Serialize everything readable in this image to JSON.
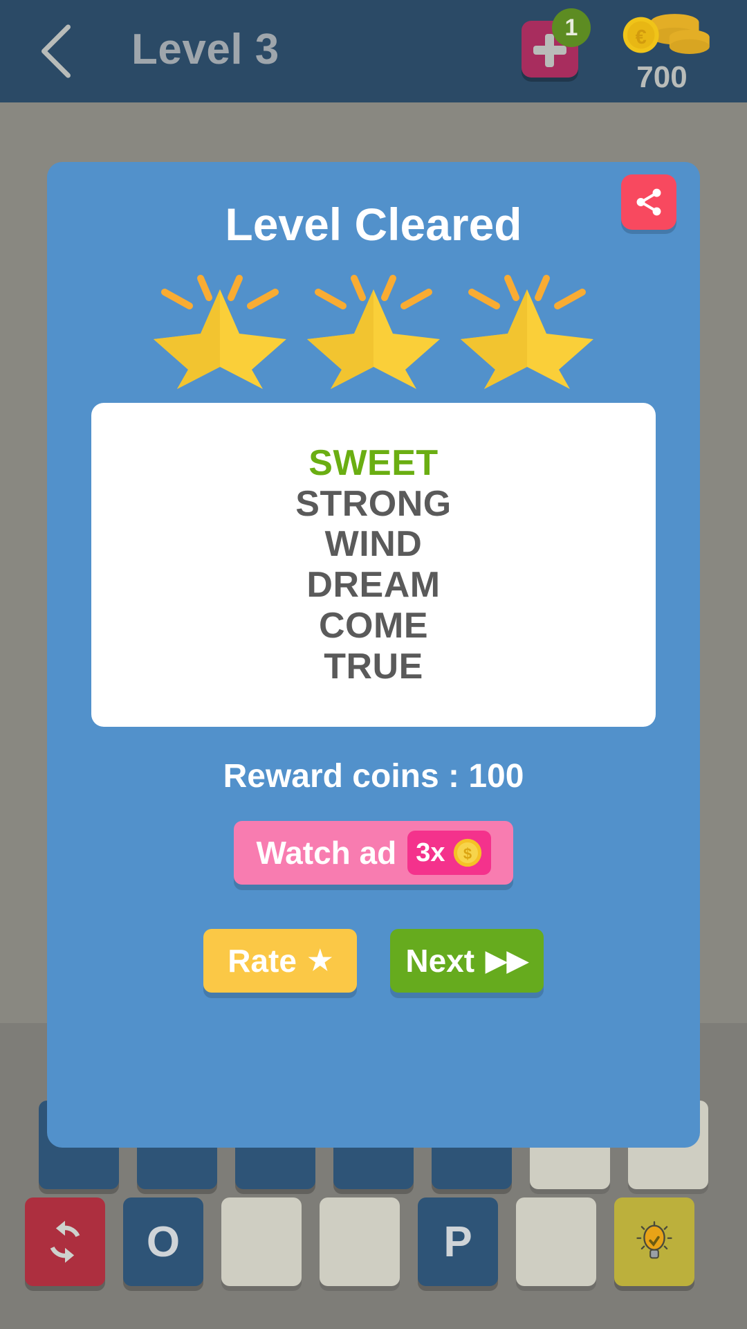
{
  "header": {
    "back_icon": "chevron-left-icon",
    "title": "Level 3",
    "add_icon": "plus-icon",
    "add_badge": "1",
    "coin_icon": "coin-stack-icon",
    "coin_count": "700",
    "bar_color": "#2b4a66",
    "title_color": "#9fa6ac",
    "plus_button_color": "#a82d5e",
    "badge_color": "#5d8c22"
  },
  "dialog": {
    "title": "Level Cleared",
    "background_color": "#5291cb",
    "share_icon": "share-icon",
    "share_button_color": "#f8495f",
    "stars": {
      "count": 3,
      "filled": 3,
      "color": "#facf39",
      "ray_color": "#f9ac33"
    },
    "words": [
      {
        "text": "SWEET",
        "highlighted": true,
        "color": "#6aae12"
      },
      {
        "text": "STRONG",
        "highlighted": false,
        "color": "#5a5a5a"
      },
      {
        "text": "WIND",
        "highlighted": false,
        "color": "#5a5a5a"
      },
      {
        "text": "DREAM",
        "highlighted": false,
        "color": "#5a5a5a"
      },
      {
        "text": "COME",
        "highlighted": false,
        "color": "#5a5a5a"
      },
      {
        "text": "TRUE",
        "highlighted": false,
        "color": "#5a5a5a"
      }
    ],
    "reward_text": "Reward coins : 100",
    "watch_ad": {
      "label": "Watch ad",
      "multiplier": "3x",
      "coin_icon": "coin-icon",
      "button_color": "#f87cb0",
      "badge_color": "#f4328c"
    },
    "actions": [
      {
        "label": "Rate",
        "glyph": "★",
        "icon": "star-icon",
        "color": "#fbc846"
      },
      {
        "label": "Next",
        "glyph": "▶▶",
        "icon": "fast-forward-icon",
        "color": "#66ab1e"
      }
    ]
  },
  "board": {
    "upper_row": [
      {
        "letter": "",
        "type": "blue"
      },
      {
        "letter": "",
        "type": "blue"
      },
      {
        "letter": "",
        "type": "blue"
      },
      {
        "letter": "",
        "type": "blue"
      },
      {
        "letter": "",
        "type": "blue"
      },
      {
        "letter": "",
        "type": "empty"
      },
      {
        "letter": "",
        "type": "empty"
      }
    ],
    "lower_row": [
      {
        "letter": "",
        "type": "red",
        "icon": "refresh-icon"
      },
      {
        "letter": "O",
        "type": "blue",
        "icon": ""
      },
      {
        "letter": "",
        "type": "empty",
        "icon": ""
      },
      {
        "letter": "",
        "type": "empty",
        "icon": ""
      },
      {
        "letter": "P",
        "type": "blue",
        "icon": ""
      },
      {
        "letter": "",
        "type": "empty",
        "icon": ""
      },
      {
        "letter": "",
        "type": "yellow",
        "icon": "lightbulb-hint-icon"
      }
    ]
  }
}
